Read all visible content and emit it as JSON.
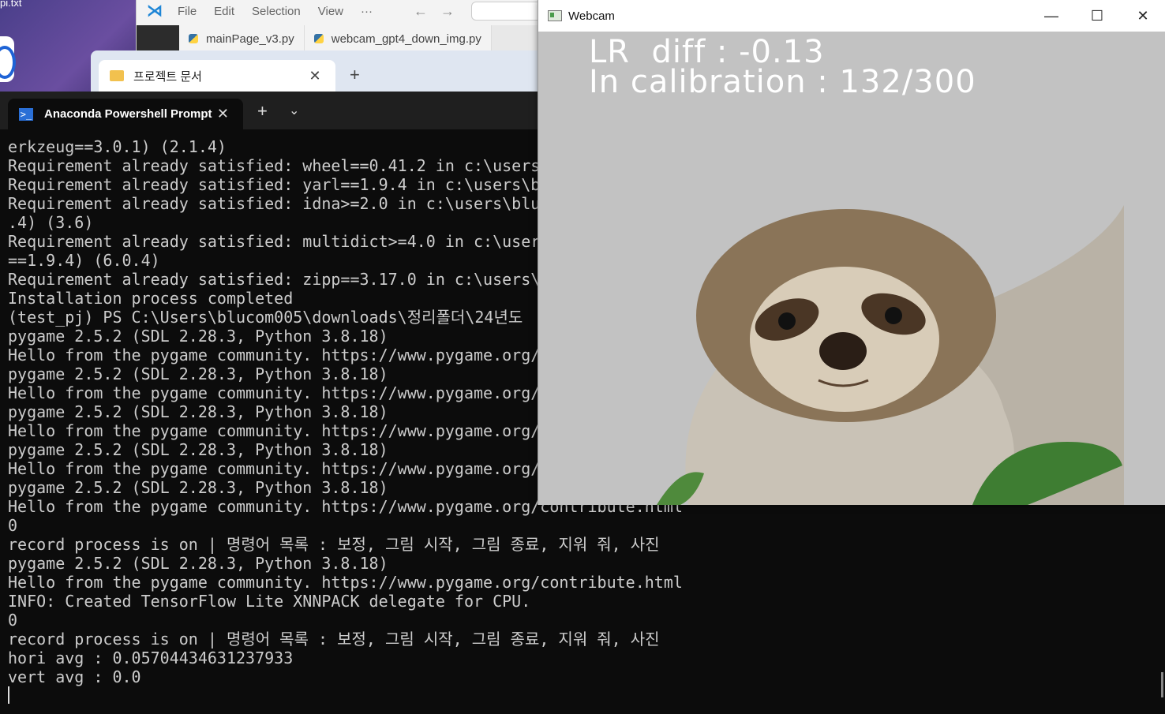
{
  "desktop": {
    "file_label": "pi.txt"
  },
  "vscode": {
    "menu": [
      "File",
      "Edit",
      "Selection",
      "View",
      "···"
    ],
    "tabs": [
      "mainPage_v3.py",
      "webcam_gpt4_down_img.py"
    ]
  },
  "explorer": {
    "tab_title": "프로젝트 문서"
  },
  "terminal": {
    "tab_title": "Anaconda Powershell Prompt",
    "lines": [
      "erkzeug==3.0.1) (2.1.4)",
      "Requirement already satisfied: wheel==0.41.2 in c:\\users",
      "Requirement already satisfied: yarl==1.9.4 in c:\\users\\b",
      "Requirement already satisfied: idna>=2.0 in c:\\users\\blu",
      ".4) (3.6)",
      "Requirement already satisfied: multidict>=4.0 in c:\\user",
      "==1.9.4) (6.0.4)",
      "Requirement already satisfied: zipp==3.17.0 in c:\\users\\",
      "Installation process completed",
      "(test_pj) PS C:\\Users\\blucom005\\downloads\\정리폴더\\24년도",
      "pygame 2.5.2 (SDL 2.28.3, Python 3.8.18)",
      "Hello from the pygame community. https://www.pygame.org/",
      "pygame 2.5.2 (SDL 2.28.3, Python 3.8.18)",
      "Hello from the pygame community. https://www.pygame.org/",
      "pygame 2.5.2 (SDL 2.28.3, Python 3.8.18)",
      "Hello from the pygame community. https://www.pygame.org/",
      "pygame 2.5.2 (SDL 2.28.3, Python 3.8.18)",
      "Hello from the pygame community. https://www.pygame.org/",
      "pygame 2.5.2 (SDL 2.28.3, Python 3.8.18)",
      "Hello from the pygame community. https://www.pygame.org/contribute.html",
      "0",
      "record process is on | 명령어 목록 : 보정, 그림 시작, 그림 종료, 지워 줘, 사진",
      "pygame 2.5.2 (SDL 2.28.3, Python 3.8.18)",
      "Hello from the pygame community. https://www.pygame.org/contribute.html",
      "INFO: Created TensorFlow Lite XNNPACK delegate for CPU.",
      "0",
      "record process is on | 명령어 목록 : 보정, 그림 시작, 그림 종료, 지워 줘, 사진",
      "hori avg : 0.05704434631237933",
      "vert avg : 0.0"
    ]
  },
  "webcam": {
    "title": "Webcam",
    "overlay_line1": "LR  diff : -0.13",
    "overlay_line2": "In calibration : 132/300",
    "minimize_glyph": "—",
    "maximize_glyph": "☐",
    "close_glyph": "✕"
  },
  "icons": {
    "vscode_logo": "vscode-logo-icon",
    "python_file": "python-file-icon",
    "folder": "folder-icon",
    "powershell": "powershell-icon"
  }
}
